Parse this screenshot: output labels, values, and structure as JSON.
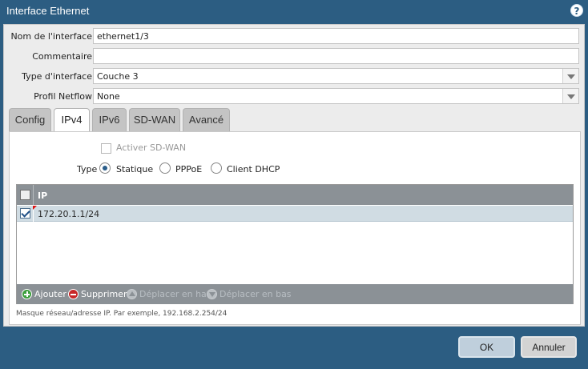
{
  "dialog": {
    "title": "Interface Ethernet",
    "help_glyph": "?"
  },
  "form": {
    "interface_name": {
      "label": "Nom de l'interface",
      "value": "ethernet1/3"
    },
    "comment": {
      "label": "Commentaire",
      "value": ""
    },
    "interface_type": {
      "label": "Type d'interface",
      "value": "Couche 3"
    },
    "netflow_profile": {
      "label": "Profil Netflow",
      "value": "None"
    }
  },
  "tabs": [
    {
      "label": "Config"
    },
    {
      "label": "IPv4"
    },
    {
      "label": "IPv6"
    },
    {
      "label": "SD-WAN"
    },
    {
      "label": "Avancé"
    }
  ],
  "active_tab": "IPv4",
  "ipv4": {
    "enable_sdwan_label": "Activer SD-WAN",
    "type_label": "Type",
    "type_options": [
      "Statique",
      "PPPoE",
      "Client DHCP"
    ],
    "type_selected": "Statique",
    "grid": {
      "column_header": "IP",
      "rows": [
        {
          "ip": "172.20.1.1/24",
          "checked": true
        }
      ]
    },
    "toolbar": {
      "add": "Ajouter",
      "delete": "Supprimer",
      "move_up": "Déplacer en haut",
      "move_down": "Déplacer en bas"
    },
    "hint": "Masque réseau/adresse IP. Par exemple, 192.168.2.254/24"
  },
  "buttons": {
    "ok": "OK",
    "cancel": "Annuler"
  },
  "colors": {
    "titlebar": "#2c5d82",
    "grid_header": "#8b9196",
    "selected_row": "#d0dce3"
  }
}
